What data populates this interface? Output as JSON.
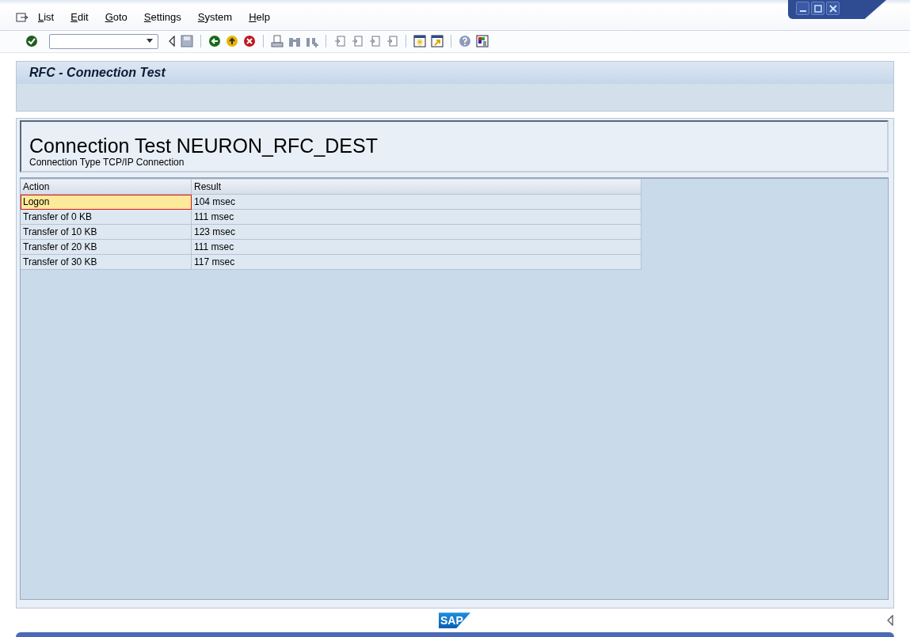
{
  "menu": [
    {
      "label": "List"
    },
    {
      "label": "Edit"
    },
    {
      "label": "Goto"
    },
    {
      "label": "Settings"
    },
    {
      "label": "System"
    },
    {
      "label": "Help"
    }
  ],
  "screen_title": "RFC - Connection Test",
  "header": {
    "title": "Connection Test NEURON_RFC_DEST",
    "subtitle": "Connection Type TCP/IP Connection"
  },
  "table": {
    "columns": [
      "Action",
      "Result"
    ],
    "rows": [
      {
        "action": "Logon",
        "result": "104 msec",
        "selected": true
      },
      {
        "action": "Transfer of 0 KB",
        "result": "111 msec",
        "selected": false
      },
      {
        "action": "Transfer of 10 KB",
        "result": "123 msec",
        "selected": false
      },
      {
        "action": "Transfer of 20 KB",
        "result": "111 msec",
        "selected": false
      },
      {
        "action": "Transfer of 30 KB",
        "result": "117 msec",
        "selected": false
      }
    ]
  },
  "logo": "SAP"
}
